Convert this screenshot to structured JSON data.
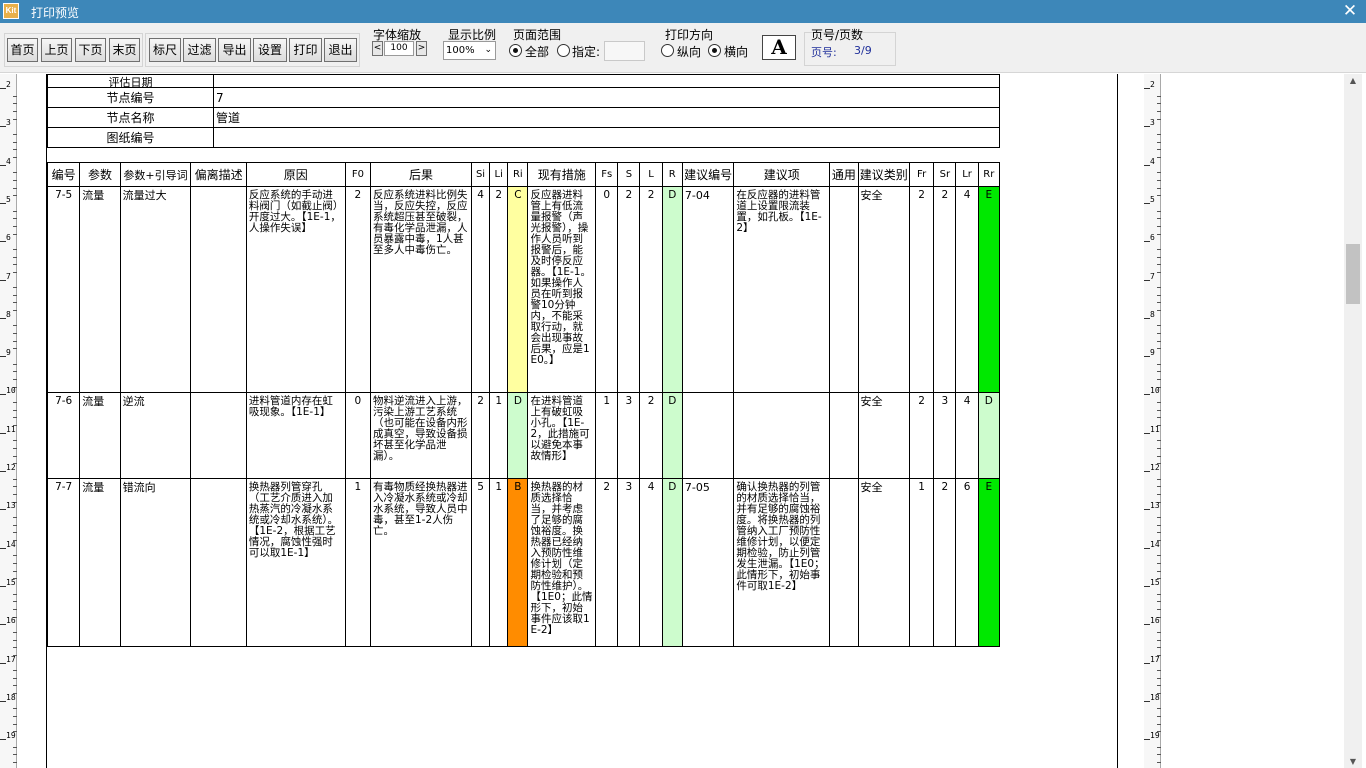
{
  "window": {
    "title": "打印预览",
    "close_icon": "✕"
  },
  "toolbar": {
    "buttons": [
      "首页",
      "上页",
      "下页",
      "末页",
      "标尺",
      "过滤",
      "导出",
      "设置",
      "打印",
      "退出"
    ],
    "font_zoom": {
      "label": "字体缩放",
      "value": "100",
      "dec": "<",
      "inc": ">"
    },
    "display_ratio": {
      "label": "显示比例",
      "value": "100%"
    },
    "page_range": {
      "label": "页面范围",
      "all": "全部",
      "specify": "指定:",
      "selected": "all"
    },
    "orientation": {
      "label": "打印方向",
      "portrait": "纵向",
      "landscape": "横向",
      "selected": "landscape"
    },
    "font_button": "A",
    "page_info": {
      "label": "页号/页数",
      "page_label": "页号:",
      "value": "3/9"
    }
  },
  "ruler": {
    "labels": [
      "2",
      "3",
      "4",
      "5",
      "6",
      "7",
      "8",
      "9",
      "10",
      "11",
      "12",
      "13",
      "14",
      "15",
      "16",
      "17",
      "18",
      "19"
    ]
  },
  "info_rows": [
    {
      "label": "评估日期",
      "value": ""
    },
    {
      "label": "节点编号",
      "value": "7"
    },
    {
      "label": "节点名称",
      "value": "管道"
    },
    {
      "label": "图纸编号",
      "value": ""
    }
  ],
  "table": {
    "headers": [
      "编号",
      "参数",
      "参数+引导词",
      "偏离描述",
      "原因",
      "F0",
      "后果",
      "Si",
      "Li",
      "Ri",
      "现有措施",
      "Fs",
      "S",
      "L",
      "R",
      "建议编号",
      "建议项",
      "通用",
      "建议类别",
      "Fr",
      "Sr",
      "Lr",
      "Rr"
    ],
    "rows": [
      {
        "id": "7-5",
        "param": "流量",
        "guide": "流量过大",
        "deviation": "",
        "cause": "反应系统的手动进料阀门（如截止阀）开度过大。【1E-1，人操作失误】",
        "f0": "2",
        "consequence": "反应系统进料比例失当，反应失控，反应系统超压甚至破裂，有毒化学品泄漏，人员暴露中毒，1人甚至多人中毒伤亡。",
        "si": "4",
        "li": "2",
        "ri": "C",
        "measures": "反应器进料管上有低流量报警（声光报警），操作人员听到报警后，能及时停反应器。【1E-1。如果操作人员在听到报警10分钟内，不能采取行动，就会出现事故后果，应是1E0。】",
        "fs": "0",
        "s": "2",
        "l": "2",
        "r": "D",
        "sugg_id": "7-04",
        "suggestion": "在反应器的进料管道上设置限流装置，如孔板。【1E-2】",
        "general": "",
        "category": "安全",
        "fr": "2",
        "sr": "2",
        "lr": "4",
        "rr": "E"
      },
      {
        "id": "7-6",
        "param": "流量",
        "guide": "逆流",
        "deviation": "",
        "cause": "进料管道内存在虹吸现象。【1E-1】",
        "f0": "0",
        "consequence": "物料逆流进入上游，污染上游工艺系统（也可能在设备内形成真空，导致设备损坏甚至化学品泄漏）。",
        "si": "2",
        "li": "1",
        "ri": "D",
        "measures": "在进料管道上有破虹吸小孔。【1E-2，此措施可以避免本事故情形】",
        "fs": "1",
        "s": "3",
        "l": "2",
        "r": "D",
        "sugg_id": "",
        "suggestion": "",
        "general": "",
        "category": "安全",
        "fr": "2",
        "sr": "3",
        "lr": "4",
        "rr": "D"
      },
      {
        "id": "7-7",
        "param": "流量",
        "guide": "错流向",
        "deviation": "",
        "cause": "换热器列管穿孔（工艺介质进入加热蒸汽的冷凝水系统或冷却水系统）。【1E-2，根据工艺情况，腐蚀性强时可以取1E-1】",
        "f0": "1",
        "consequence": "有毒物质经换热器进入冷凝水系统或冷却水系统，导致人员中毒，甚至1-2人伤亡。",
        "si": "5",
        "li": "1",
        "ri": "B",
        "measures": "换热器的材质选择恰当，并考虑了足够的腐蚀裕度。换热器已经纳入预防性维修计划（定期检验和预防性维护）。【1E0；此情形下，初始事件应该取1E-2】",
        "fs": "2",
        "s": "3",
        "l": "4",
        "r": "D",
        "sugg_id": "7-05",
        "suggestion": "确认换热器的列管的材质选择恰当，并有足够的腐蚀裕度。将换热器的列管纳入工厂预防性维修计划，以便定期检验，防止列管发生泄漏。【1E0；此情形下，初始事件可取1E-2】",
        "general": "",
        "category": "安全",
        "fr": "1",
        "sr": "2",
        "lr": "6",
        "rr": "E"
      }
    ]
  },
  "colors": {
    "titlebar": "#3d87b9",
    "risk_C": "#ffffa0",
    "risk_D": "#cdfccd",
    "risk_E": "#00e800",
    "risk_B": "#ff8c00"
  }
}
